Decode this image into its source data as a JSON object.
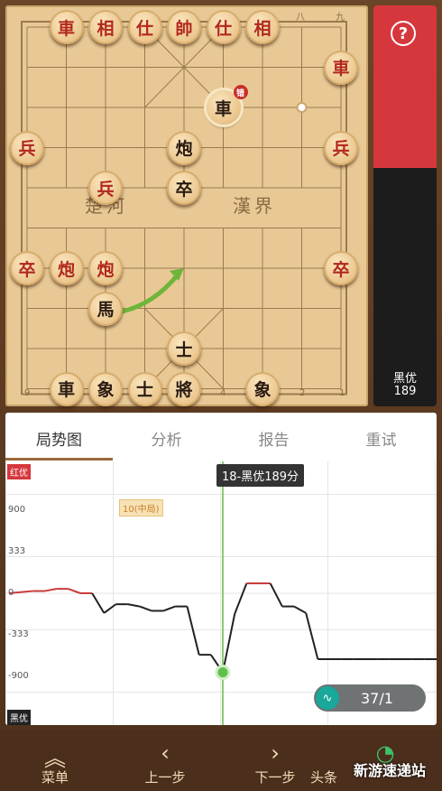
{
  "board": {
    "file_labels_top": [
      "八",
      "九"
    ],
    "file_labels_bottom": [
      "9",
      "4",
      "2",
      "1"
    ],
    "river_left": "楚河",
    "river_right": "漢界",
    "move_badge": "错",
    "pieces": [
      {
        "id": "r-chariot-top",
        "text": "車",
        "side": "red",
        "col": 1,
        "row": 0
      },
      {
        "id": "r-minister-top",
        "text": "相",
        "side": "red",
        "col": 2,
        "row": 0
      },
      {
        "id": "r-advisor-top-1",
        "text": "仕",
        "side": "red",
        "col": 3,
        "row": 0
      },
      {
        "id": "r-king",
        "text": "帥",
        "side": "red",
        "col": 4,
        "row": 0
      },
      {
        "id": "r-advisor-top-2",
        "text": "仕",
        "side": "red",
        "col": 5,
        "row": 0
      },
      {
        "id": "r-minister-top-2",
        "text": "相",
        "side": "red",
        "col": 6,
        "row": 0
      },
      {
        "id": "r-chariot-right",
        "text": "車",
        "side": "red",
        "col": 8,
        "row": 1
      },
      {
        "id": "b-chariot-selected",
        "text": "車",
        "side": "black",
        "col": 5,
        "row": 2,
        "selected": true,
        "badge": true
      },
      {
        "id": "r-soldier-left",
        "text": "兵",
        "side": "red",
        "col": 0,
        "row": 3
      },
      {
        "id": "b-cannon-mid",
        "text": "炮",
        "side": "black",
        "col": 4,
        "row": 3
      },
      {
        "id": "r-soldier-right",
        "text": "兵",
        "side": "red",
        "col": 8,
        "row": 3
      },
      {
        "id": "r-soldier-mid",
        "text": "兵",
        "side": "red",
        "col": 2,
        "row": 4
      },
      {
        "id": "b-pawn-mid",
        "text": "卒",
        "side": "black",
        "col": 4,
        "row": 4
      },
      {
        "id": "r-pawn-left",
        "text": "卒",
        "side": "red",
        "col": 0,
        "row": 6
      },
      {
        "id": "r-cannon-1",
        "text": "炮",
        "side": "red",
        "col": 1,
        "row": 6
      },
      {
        "id": "r-cannon-2",
        "text": "炮",
        "side": "red",
        "col": 2,
        "row": 6
      },
      {
        "id": "r-pawn-right",
        "text": "卒",
        "side": "red",
        "col": 8,
        "row": 6
      },
      {
        "id": "b-horse",
        "text": "馬",
        "side": "black",
        "col": 2,
        "row": 7
      },
      {
        "id": "b-advisor-mid",
        "text": "士",
        "side": "black",
        "col": 4,
        "row": 8
      },
      {
        "id": "b-chariot-bottom",
        "text": "車",
        "side": "black",
        "col": 1,
        "row": 9
      },
      {
        "id": "b-elephant-left",
        "text": "象",
        "side": "black",
        "col": 2,
        "row": 9
      },
      {
        "id": "b-advisor-bottom",
        "text": "士",
        "side": "black",
        "col": 3,
        "row": 9
      },
      {
        "id": "b-general",
        "text": "將",
        "side": "black",
        "col": 4,
        "row": 9
      },
      {
        "id": "b-elephant-right",
        "text": "象",
        "side": "black",
        "col": 6,
        "row": 9
      }
    ]
  },
  "side_panel": {
    "help_label": "?",
    "advantage_label": "黑优",
    "advantage_value": "189"
  },
  "tabs": [
    "局势图",
    "分析",
    "报告",
    "重试"
  ],
  "chart_data": {
    "type": "line",
    "ylabels": [
      "900",
      "333",
      "0",
      "-333",
      "-900"
    ],
    "ylim": [
      -1200,
      1200
    ],
    "top_tag": "红优",
    "bottom_tag": "黑优",
    "mid_tag": "10(中局)",
    "tooltip": "18-黑优189分",
    "current_move": 18,
    "moves": 37,
    "values": [
      0,
      10,
      20,
      20,
      40,
      40,
      0,
      0,
      -180,
      -100,
      -100,
      -120,
      -160,
      -160,
      -120,
      -120,
      -560,
      -560,
      -720,
      -189,
      90,
      90,
      90,
      -120,
      -120,
      -180,
      -600,
      -600,
      -600,
      -600,
      -600,
      -600,
      -600,
      -600,
      -600,
      -600,
      -600
    ]
  },
  "counter": {
    "text": "37/1"
  },
  "bottom_nav": [
    {
      "id": "menu",
      "icon": "︽",
      "label": "菜单"
    },
    {
      "id": "prev",
      "icon": "‹",
      "label": "上一步"
    },
    {
      "id": "next",
      "icon": "›",
      "label": "下一步"
    },
    {
      "id": "toutiao",
      "icon": "◔",
      "label": "头条"
    }
  ],
  "watermark": "新游速递站",
  "colors": {
    "red_side": "#d6373d",
    "black_side": "#1c1c1c",
    "board": "#e8c995",
    "red_line": "#c83a3a",
    "black_line": "#222222",
    "cursor": "#5fbf4a"
  }
}
